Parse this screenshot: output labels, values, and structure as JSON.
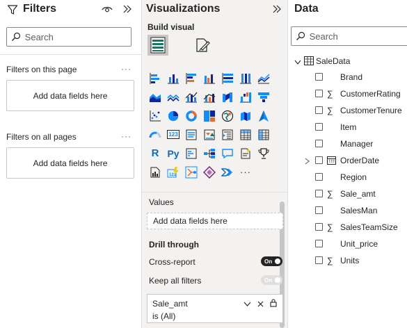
{
  "filters": {
    "title": "Filters",
    "search_placeholder": "Search",
    "on_page_label": "Filters on this page",
    "on_page_well": "Add data fields here",
    "all_pages_label": "Filters on all pages",
    "all_pages_well": "Add data fields here",
    "more": "···"
  },
  "viz": {
    "title": "Visualizations",
    "build_label": "Build visual",
    "values_label": "Values",
    "values_well": "Add data fields here",
    "drill_label": "Drill through",
    "cross_report_label": "Cross-report",
    "cross_report_toggle": "On",
    "keep_filters_label": "Keep all filters",
    "keep_filters_toggle": "On",
    "filter_card": {
      "name": "Sale_amt",
      "value": "is (All)"
    },
    "icons": [
      "stacked-bar-chart-icon",
      "stacked-column-chart-icon",
      "clustered-bar-chart-icon",
      "clustered-column-chart-icon",
      "100-stacked-bar-chart-icon",
      "100-stacked-column-chart-icon",
      "line-chart-icon",
      "",
      "area-chart-icon",
      "stacked-area-chart-icon",
      "line-stacked-column-icon",
      "line-clustered-column-icon",
      "ribbon-chart-icon",
      "waterfall-chart-icon",
      "funnel-chart-icon",
      "",
      "scatter-chart-icon",
      "pie-chart-icon",
      "donut-chart-icon",
      "treemap-icon",
      "map-icon",
      "filled-map-icon",
      "azure-map-icon",
      "",
      "gauge-icon",
      "card-icon",
      "multi-row-card-icon",
      "kpi-icon",
      "slicer-icon",
      "table-icon",
      "matrix-icon",
      "",
      "r-visual-icon",
      "python-visual-icon",
      "key-influencers-icon",
      "decomposition-tree-icon",
      "qa-icon",
      "smart-narrative-icon",
      "goals-icon",
      "",
      "paginated-report-icon",
      "power-apps-icon",
      "power-automate-icon",
      "power-apps-diamond-icon",
      "power-automate-chevron-icon",
      "more-visuals-icon",
      "",
      ""
    ],
    "text_icons": {
      "py": "Py",
      "r": "R",
      "card": "123",
      "more": "···"
    }
  },
  "data": {
    "title": "Data",
    "search_placeholder": "Search",
    "table_name": "SaleData",
    "fields": [
      {
        "name": "Brand",
        "sigma": false,
        "calendar": false,
        "expand": false
      },
      {
        "name": "CustomerRating",
        "sigma": true,
        "calendar": false,
        "expand": false
      },
      {
        "name": "CustomerTenure",
        "sigma": true,
        "calendar": false,
        "expand": false
      },
      {
        "name": "Item",
        "sigma": false,
        "calendar": false,
        "expand": false
      },
      {
        "name": "Manager",
        "sigma": false,
        "calendar": false,
        "expand": false
      },
      {
        "name": "OrderDate",
        "sigma": false,
        "calendar": true,
        "expand": true
      },
      {
        "name": "Region",
        "sigma": false,
        "calendar": false,
        "expand": false
      },
      {
        "name": "Sale_amt",
        "sigma": true,
        "calendar": false,
        "expand": false
      },
      {
        "name": "SalesMan",
        "sigma": false,
        "calendar": false,
        "expand": false
      },
      {
        "name": "SalesTeamSize",
        "sigma": true,
        "calendar": false,
        "expand": false
      },
      {
        "name": "Unit_price",
        "sigma": false,
        "calendar": false,
        "expand": false
      },
      {
        "name": "Units",
        "sigma": true,
        "calendar": false,
        "expand": false
      }
    ],
    "sigma_glyph": "∑"
  },
  "colors": {
    "accent_blue": "#118dff",
    "dark_blue": "#0f6cbd",
    "orange": "#e66c37",
    "yellow": "#f2c80f",
    "purple": "#8a3ffc",
    "teal": "#12239e"
  }
}
